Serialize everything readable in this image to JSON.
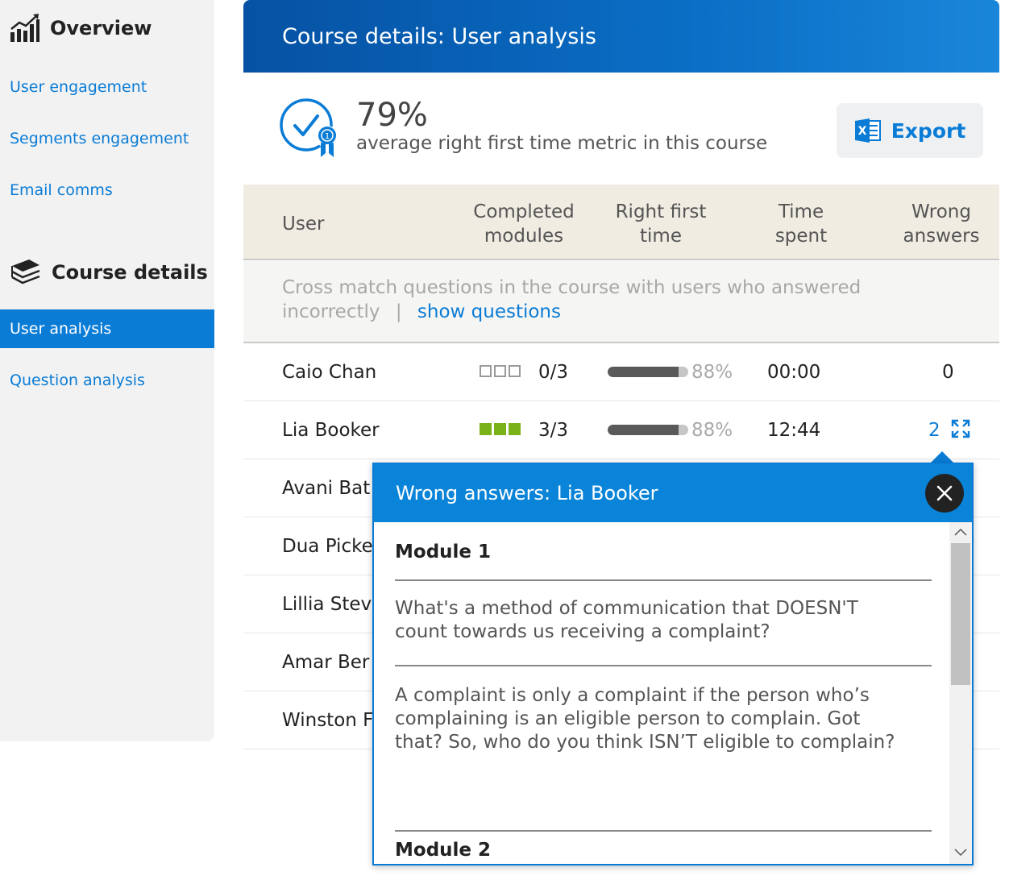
{
  "sidebar": {
    "overview_heading": "Overview",
    "overview_items": [
      {
        "label": "User engagement"
      },
      {
        "label": "Segments engagement"
      },
      {
        "label": "Email comms"
      }
    ],
    "course_heading": "Course details",
    "course_items": [
      {
        "label": "User analysis",
        "active": true
      },
      {
        "label": "Question analysis",
        "active": false
      }
    ]
  },
  "header": {
    "title": "Course details: User analysis"
  },
  "metric": {
    "value": "79%",
    "label": "average right first time metric in this course",
    "icon": "badge-check-icon"
  },
  "export": {
    "label": "Export",
    "icon": "excel-icon"
  },
  "table": {
    "columns": {
      "user": "User",
      "completed_1": "Completed",
      "completed_2": "modules",
      "rft_1": "Right first",
      "rft_2": "time",
      "time_1": "Time",
      "time_2": "spent",
      "wrong_1": "Wrong",
      "wrong_2": "answers"
    },
    "cross_match": {
      "text": "Cross match questions in the course with users who answered incorrectly",
      "separator": "|",
      "link": "show questions"
    },
    "rows": [
      {
        "user": "Caio Chan",
        "modules_done": 0,
        "modules_total": 3,
        "modules": "0/3",
        "rft_value": 0.88,
        "rft": "88%",
        "time": "00:00",
        "wrong": "0"
      },
      {
        "user": "Lia Booker",
        "modules_done": 3,
        "modules_total": 3,
        "modules": "3/3",
        "rft_value": 0.88,
        "rft": "88%",
        "time": "12:44",
        "wrong": "2"
      },
      {
        "user": "Avani Bat"
      },
      {
        "user": "Dua Picke"
      },
      {
        "user": "Lillia Stev"
      },
      {
        "user": "Amar Ber"
      },
      {
        "user": "Winston F"
      }
    ]
  },
  "popup": {
    "title": "Wrong answers: Lia Booker",
    "modules": [
      {
        "title": "Module 1",
        "questions": [
          "What's a method of communication that DOESN'T count towards us receiving a complaint?",
          "A complaint is only a complaint if the person who’s complaining is an eligible person to complain. Got that? So, who do you think ISN’T eligible to complain?"
        ]
      },
      {
        "title": "Module 2"
      }
    ]
  },
  "colors": {
    "accent": "#0a7cd6",
    "header_start": "#0651a3",
    "progress_green": "#7ab317",
    "table_header_bg": "#f0ece2"
  }
}
